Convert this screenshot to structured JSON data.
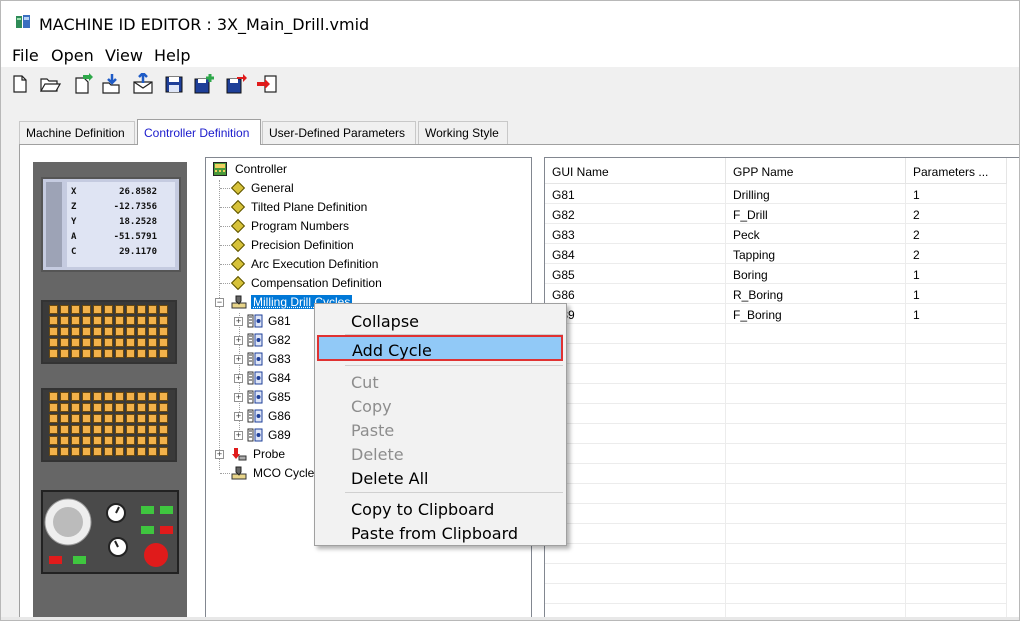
{
  "window": {
    "title": "MACHINE ID EDITOR : 3X_Main_Drill.vmid"
  },
  "menubar": {
    "items": [
      "File",
      "Open",
      "View",
      "Help"
    ]
  },
  "toolbar": {
    "buttons": [
      "new-file-icon",
      "open-folder-icon",
      "new-from-template-icon",
      "import-icon",
      "export-icon",
      "save-icon",
      "save-add-icon",
      "save-as-icon",
      "exit-icon"
    ]
  },
  "tabs": [
    {
      "label": "Machine Definition",
      "active": false
    },
    {
      "label": "Controller Definition",
      "active": true
    },
    {
      "label": "User-Defined Parameters",
      "active": false
    },
    {
      "label": "Working Style",
      "active": false
    }
  ],
  "controller_image": {
    "axes": [
      {
        "axis": "X",
        "value": "26.8582"
      },
      {
        "axis": "Z",
        "value": "-12.7356"
      },
      {
        "axis": "Y",
        "value": "18.2528"
      },
      {
        "axis": "A",
        "value": "-51.5791"
      },
      {
        "axis": "C",
        "value": "29.1170"
      }
    ]
  },
  "tree": {
    "root": "Controller",
    "items": [
      {
        "label": "General"
      },
      {
        "label": "Tilted Plane Definition"
      },
      {
        "label": "Program Numbers"
      },
      {
        "label": "Precision Definition"
      },
      {
        "label": "Arc Execution Definition"
      },
      {
        "label": "Compensation Definition"
      }
    ],
    "milling": {
      "label": "Milling Drill Cycles",
      "children": [
        "G81",
        "G82",
        "G83",
        "G84",
        "G85",
        "G86",
        "G89"
      ]
    },
    "probe": "Probe",
    "mco": "MCO Cycles"
  },
  "grid": {
    "headers": [
      "GUI Name",
      "GPP Name",
      "Parameters ..."
    ],
    "rows": [
      [
        "G81",
        "Drilling",
        "1"
      ],
      [
        "G82",
        "F_Drill",
        "2"
      ],
      [
        "G83",
        "Peck",
        "2"
      ],
      [
        "G84",
        "Tapping",
        "2"
      ],
      [
        "G85",
        "Boring",
        "1"
      ],
      [
        "G86",
        "R_Boring",
        "1"
      ],
      [
        "G89",
        "F_Boring",
        "1"
      ]
    ]
  },
  "context_menu": {
    "items": [
      {
        "label": "Collapse",
        "enabled": true
      },
      {
        "label": "Add Cycle",
        "enabled": true,
        "highlighted": true
      },
      {
        "label": "Cut",
        "enabled": false
      },
      {
        "label": "Copy",
        "enabled": false
      },
      {
        "label": "Paste",
        "enabled": false
      },
      {
        "label": "Delete",
        "enabled": false
      },
      {
        "label": "Delete All",
        "enabled": true
      },
      {
        "label": "Copy to Clipboard",
        "enabled": true
      },
      {
        "label": "Paste from Clipboard",
        "enabled": true
      }
    ]
  },
  "colors": {
    "selection": "#0078d7",
    "highlight_menu": "#91c9f7",
    "highlight_border": "#e03232",
    "active_tab_text": "#1b1bcc"
  }
}
